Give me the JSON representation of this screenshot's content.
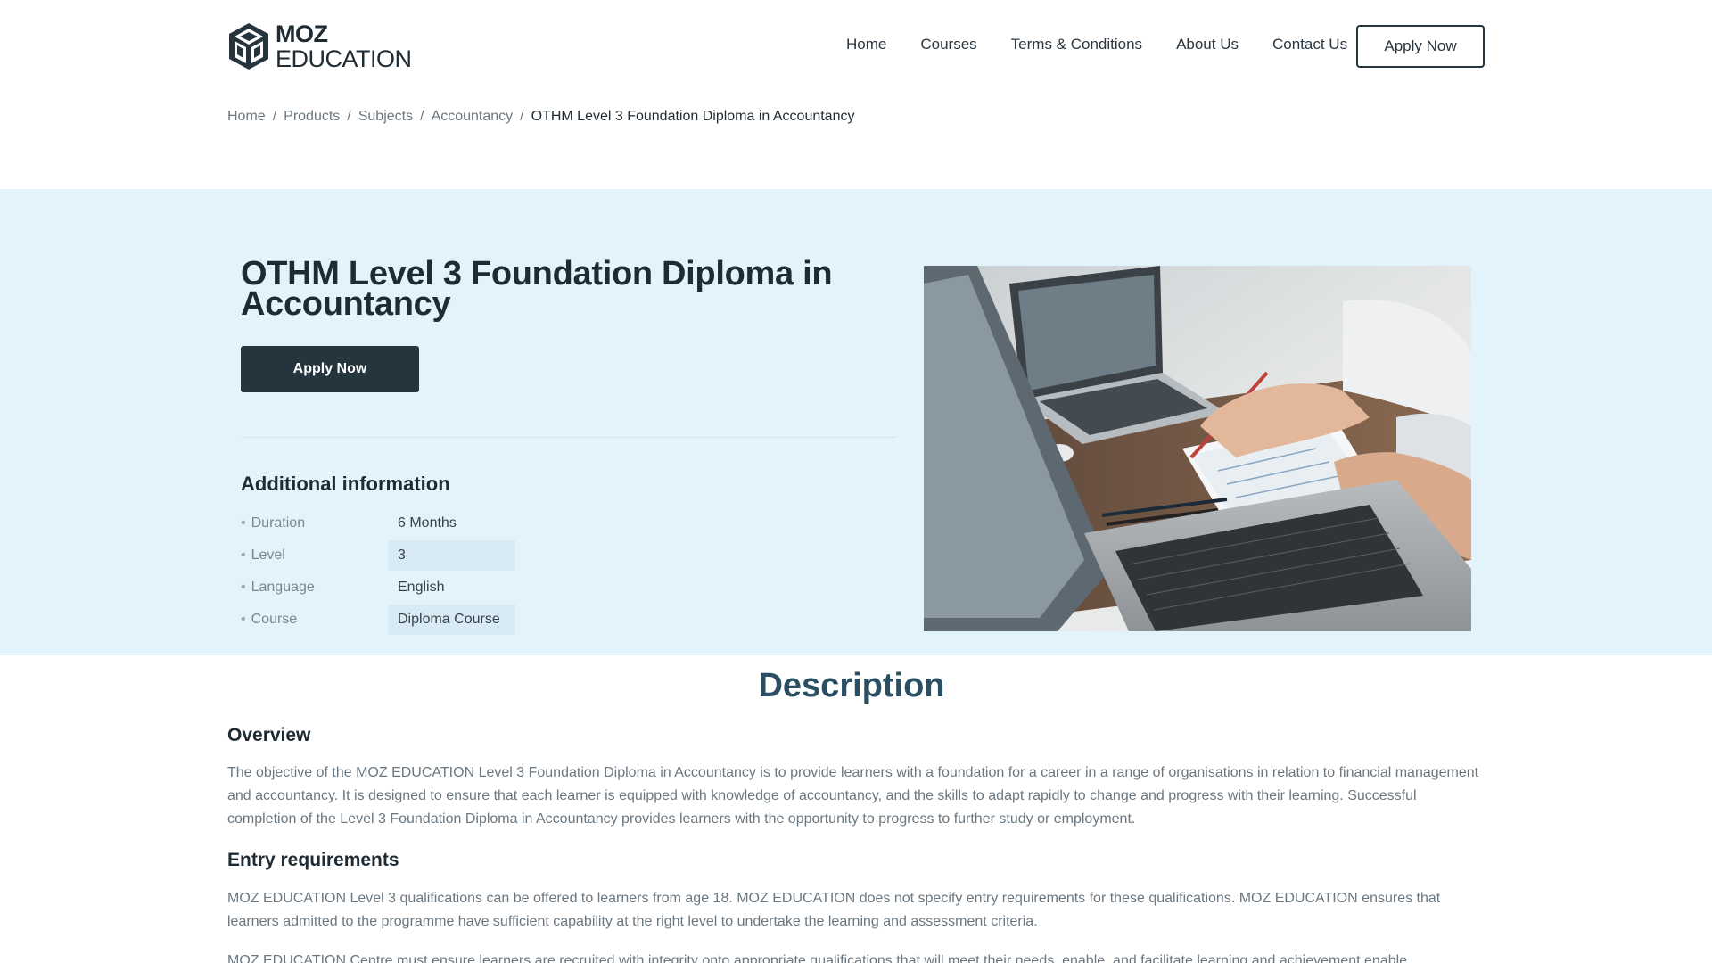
{
  "logo": {
    "line1": "MOZ",
    "line2": "EDUCATION"
  },
  "nav": {
    "home": "Home",
    "courses": "Courses",
    "terms": "Terms & Conditions",
    "about": "About Us",
    "contact": "Contact Us",
    "apply": "Apply Now"
  },
  "breadcrumb": {
    "home": "Home",
    "products": "Products",
    "subjects": "Subjects",
    "accountancy": "Accountancy",
    "current": "OTHM Level 3 Foundation Diploma in Accountancy",
    "sep": "/"
  },
  "hero": {
    "title_line1": "OTHM Level 3 Foundation Diploma in",
    "title_line2": "Accountancy",
    "apply": "Apply Now",
    "additional_heading": "Additional information",
    "info": [
      {
        "key": "Duration",
        "value": "6 Months"
      },
      {
        "key": "Level",
        "value": "3"
      },
      {
        "key": "Language",
        "value": "English"
      },
      {
        "key": "Course",
        "value": "Diploma Course"
      }
    ]
  },
  "description": {
    "title": "Description",
    "overview_heading": "Overview",
    "overview_p1": "The objective of the MOZ EDUCATION Level 3 Foundation Diploma in Accountancy is to provide learners with a foundation for a career in a range of organisations in relation to financial management and accountancy. It is designed to ensure that each learner is equipped with knowledge of accountancy, and the skills to adapt rapidly to change and progress with their learning. Successful completion of the Level 3 Foundation Diploma in Accountancy provides learners with the opportunity to progress to further study or employment.",
    "entry_heading": "Entry requirements",
    "entry_p1": "MOZ EDUCATION Level 3 qualifications can be offered to learners from age 18. MOZ EDUCATION does not specify entry requirements for these qualifications. MOZ EDUCATION ensures that learners admitted to the programme have sufficient capability at the right level to undertake the learning and assessment criteria.",
    "entry_p2": "MOZ EDUCATION Centre must ensure learners are recruited with integrity onto appropriate qualifications that will meet their needs, enable, and facilitate learning and achievement enable progression. The"
  }
}
